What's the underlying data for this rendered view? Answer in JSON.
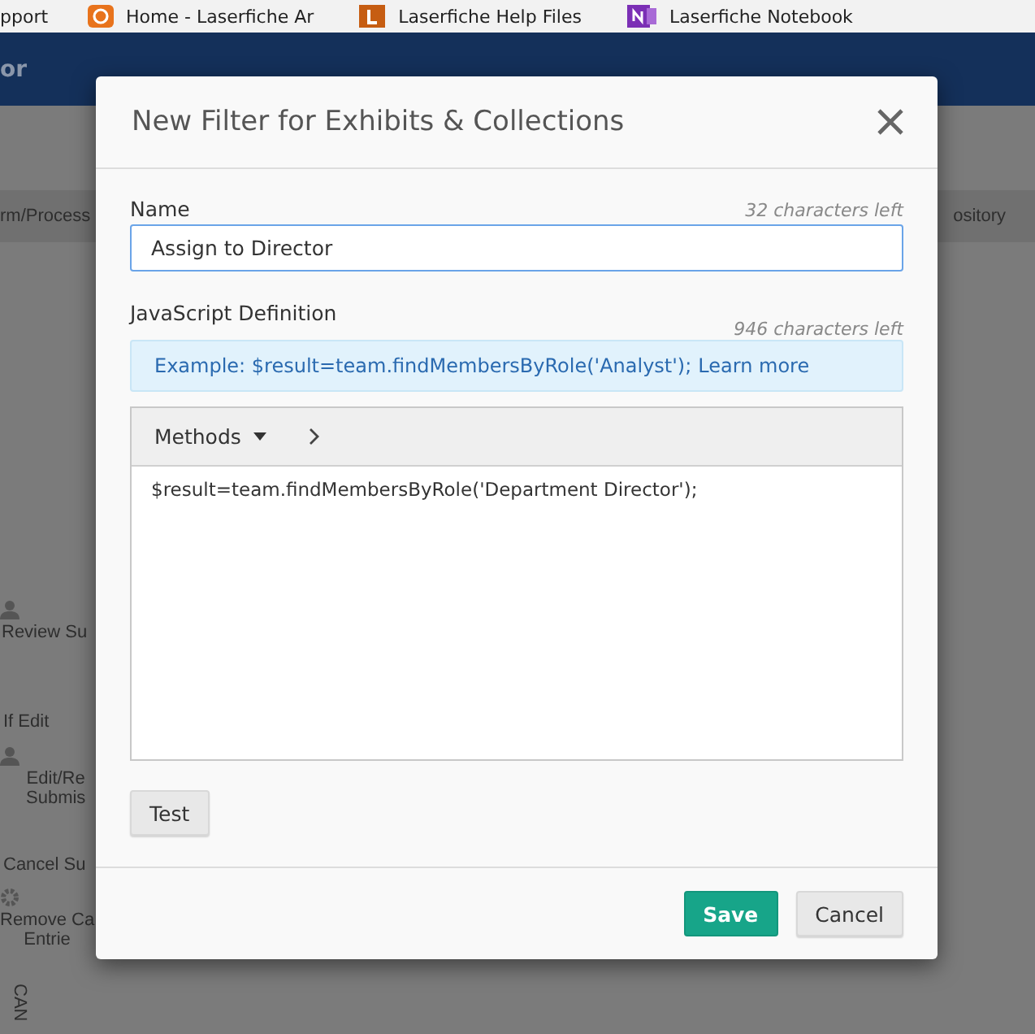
{
  "bookmarks": [
    {
      "label": "pport"
    },
    {
      "label": "Home - Laserfiche Ar"
    },
    {
      "label": "Laserfiche Help Files"
    },
    {
      "label": "Laserfiche Notebook"
    }
  ],
  "app_header": {
    "title": "or"
  },
  "background": {
    "tabs": [
      "rm/Process",
      "ository"
    ],
    "diagram_labels": [
      {
        "text": "Review Su",
        "kind": "user-task"
      },
      {
        "text": "If Edit",
        "kind": "flow-label"
      },
      {
        "text": "Edit/Re\nSubmis",
        "kind": "user-task"
      },
      {
        "text": "Cancel Su",
        "kind": "flow-label"
      },
      {
        "text": "Remove Ca\nEntrie",
        "kind": "service-task"
      },
      {
        "text": "CAN",
        "kind": "vertical-label"
      }
    ]
  },
  "dialog": {
    "title": "New Filter for Exhibits & Collections",
    "name_field": {
      "label": "Name",
      "counter": "32 characters left",
      "value": "Assign to Director"
    },
    "definition": {
      "label": "JavaScript Definition",
      "counter": "946 characters left",
      "example": "Example: $result=team.findMembersByRole('Analyst');",
      "learn_more": "Learn more",
      "methods_menu": "Methods",
      "code": "$result=team.findMembersByRole('Department Director');"
    },
    "test_button": "Test",
    "buttons": [
      {
        "label": "Save",
        "kind": "primary"
      },
      {
        "label": "Cancel",
        "kind": "secondary"
      }
    ]
  }
}
